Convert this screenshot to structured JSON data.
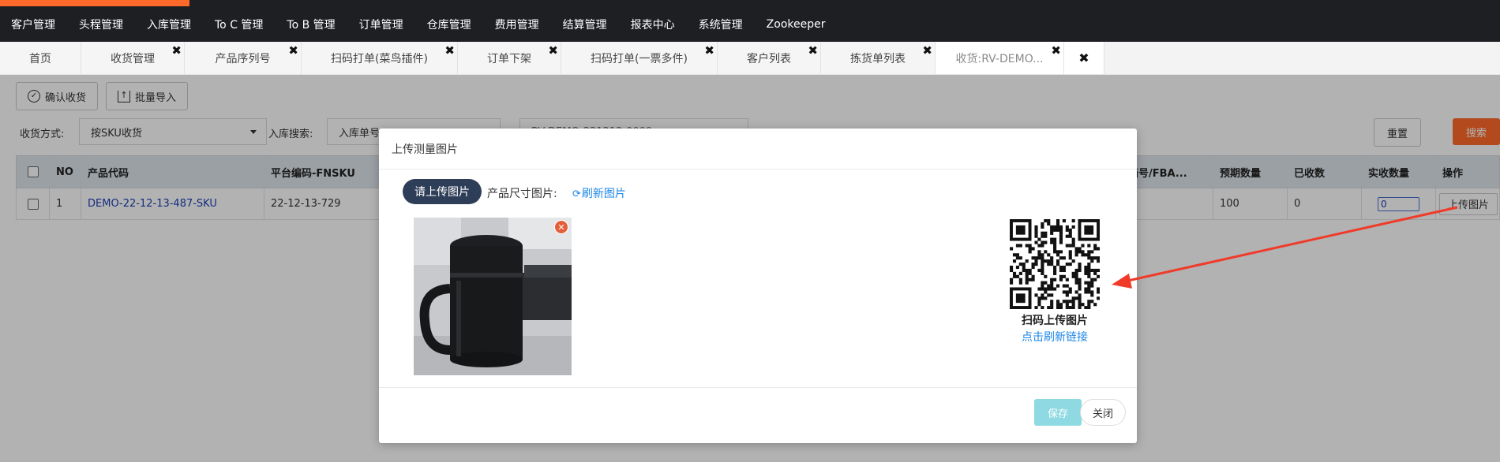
{
  "top_menu": {
    "accent_color": "#ff6a2a",
    "items": [
      "客户管理",
      "头程管理",
      "入库管理",
      "To C 管理",
      "To B 管理",
      "订单管理",
      "仓库管理",
      "费用管理",
      "结算管理",
      "报表中心",
      "系统管理",
      "Zookeeper"
    ]
  },
  "tabs": [
    {
      "label": "首页",
      "closable": false
    },
    {
      "label": "收货管理",
      "closable": true
    },
    {
      "label": "产品序列号",
      "closable": true
    },
    {
      "label": "扫码打单(菜鸟插件)",
      "closable": true
    },
    {
      "label": "订单下架",
      "closable": true
    },
    {
      "label": "扫码打单(一票多件)",
      "closable": true
    },
    {
      "label": "客户列表",
      "closable": true
    },
    {
      "label": "拣货单列表",
      "closable": true
    },
    {
      "label": "收货:RV-DEMO...",
      "closable": true,
      "active": true
    }
  ],
  "tab_close_all_icon": "close-icon",
  "toolbar": {
    "confirm_label": "确认收货",
    "import_label": "批量导入"
  },
  "filters": {
    "method_label": "收货方式:",
    "method_value": "按SKU收货",
    "search_label": "入库搜索:",
    "search_field_value": "入库单号",
    "search_input_value": "RV-DEMO-221212-0009",
    "reset_label": "重置",
    "search_label_btn": "搜索"
  },
  "table": {
    "headers": {
      "no": "NO",
      "product_code": "产品代码",
      "platform_code": "平台编码-FNSKU",
      "fba": "箱号/FBA...",
      "expected": "预期数量",
      "received": "已收数",
      "actual": "实收数量",
      "action": "操作"
    },
    "rows": [
      {
        "no": "1",
        "product_code": "DEMO-22-12-13-487-SKU",
        "platform_code": "22-12-13-729",
        "fba": "-",
        "expected": "100",
        "received": "0",
        "actual": "0",
        "action": "上传图片"
      }
    ]
  },
  "modal": {
    "title": "上传测量图片",
    "upload_button": "请上传图片",
    "size_label": "产品尺寸图片:",
    "refresh_label": "刷新图片",
    "refresh_icon": "refresh-icon",
    "remove_icon": "close-icon",
    "qr_caption": "扫码上传图片",
    "qr_refresh": "点击刷新链接",
    "save_label": "保存",
    "close_label": "关闭",
    "annotation_color": "#f03a2a"
  }
}
